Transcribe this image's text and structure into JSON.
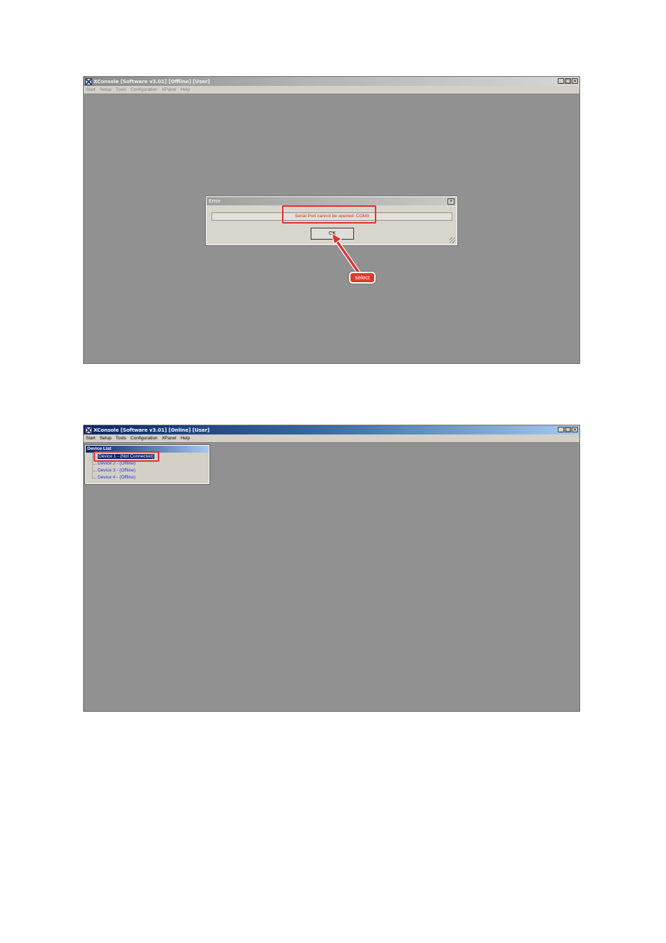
{
  "window1": {
    "title": "XConsole [Software v3.01] [Offline] [User]",
    "controls": [
      "_",
      "□",
      "×"
    ],
    "menu": [
      "Start",
      "Setup",
      "Tools",
      "Configuration",
      "XPanel",
      "Help"
    ],
    "dialog": {
      "title": "Error",
      "close": "×",
      "message": "Serial Port cannot be opened: COM3",
      "ok_label": "OK"
    },
    "callout": "select"
  },
  "window2": {
    "title": "XConsole [Software v3.01] [Online] [User]",
    "controls": [
      "_",
      "□",
      "×"
    ],
    "menu": [
      "Start",
      "Setup",
      "Tools",
      "Configuration",
      "XPanel",
      "Help"
    ],
    "device_list": {
      "header": "Device List",
      "items": [
        {
          "label": "Device 1 - (Not Connected)",
          "selected": true
        },
        {
          "label": "Device 2 - (Offline)",
          "selected": false
        },
        {
          "label": "Device 3 - (Offline)",
          "selected": false
        },
        {
          "label": "Device 4 - (Offline)",
          "selected": false
        }
      ]
    }
  },
  "colors": {
    "workspace": "#919191",
    "highlight": "#e03030",
    "message_text": "#cc2a2a",
    "active_title": "#0a246a"
  }
}
